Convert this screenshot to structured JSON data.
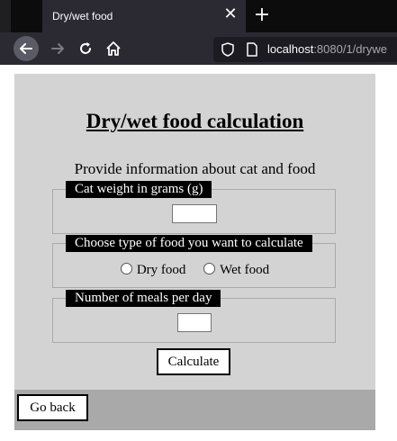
{
  "browser": {
    "tab_title": "Dry/wet food",
    "tab_close_glyph": "✕",
    "new_tab_glyph": "+",
    "url_host": "localhost",
    "url_rest": ":8080/1/drywe"
  },
  "page": {
    "title": "Dry/wet food calculation",
    "info": "Provide information about cat and food",
    "weight_legend": "Cat weight in grams (g)",
    "weight_value": "",
    "food_legend": "Choose type of food you want to calculate",
    "dry_label": "Dry food",
    "wet_label": "Wet food",
    "meals_legend": "Number of meals per day",
    "meals_value": "",
    "calculate_label": "Calculate",
    "go_back_label": "Go back"
  },
  "colors": {
    "page_bg": "#d3d3d3",
    "bottom_bar": "#a9a9a9",
    "legend_bg": "#000000"
  }
}
